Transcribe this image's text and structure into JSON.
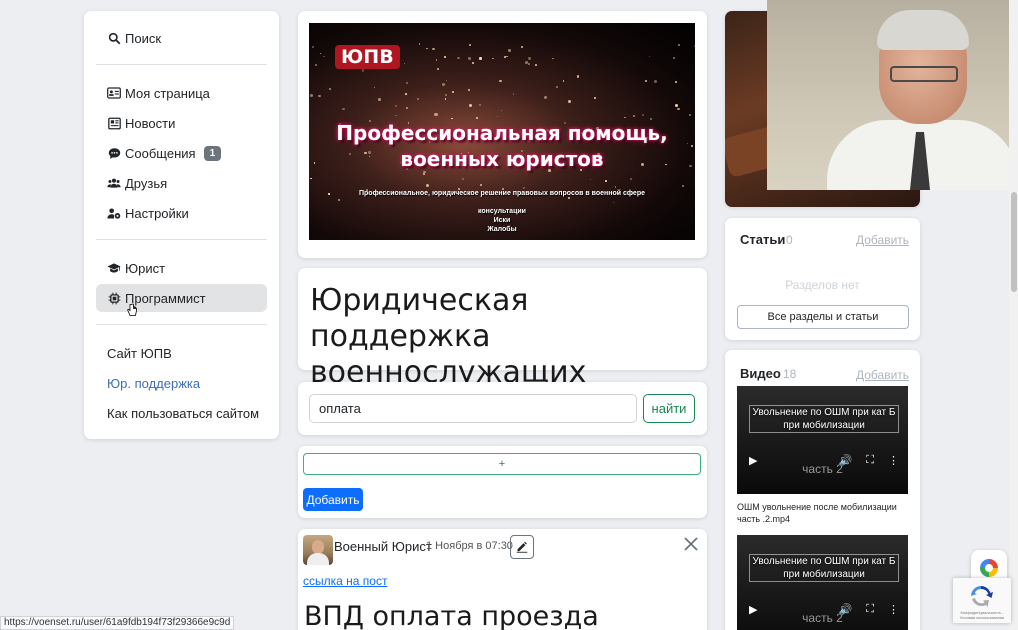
{
  "menu": {
    "search": "Поиск",
    "items": [
      {
        "label": "Моя страница",
        "icon": "id-card-icon"
      },
      {
        "label": "Новости",
        "icon": "newspaper-icon"
      },
      {
        "label": "Сообщения",
        "icon": "chat-icon",
        "badge": "1"
      },
      {
        "label": "Друзья",
        "icon": "users-icon"
      },
      {
        "label": "Настройки",
        "icon": "user-gear-icon"
      }
    ],
    "roles": [
      {
        "label": "Юрист",
        "icon": "graduation-cap-icon"
      },
      {
        "label": "Программист",
        "icon": "chip-icon"
      }
    ],
    "links": [
      "Сайт ЮПВ",
      "Юр. поддержка",
      "Как пользоваться сайтом"
    ]
  },
  "banner": {
    "logo": "ЮПВ",
    "title_line1": "Профессиональная помощь,",
    "title_line2": "военных юристов",
    "subtitle": "Профессиональное, юридическое решение правовых вопросов в военной сфере",
    "lines": [
      "консультации",
      "Иски",
      "Жалобы"
    ]
  },
  "page_title": "Юридическая поддержка военнослужащих",
  "search": {
    "value": "оплата",
    "button": "найти"
  },
  "add_block": {
    "plus": "+",
    "button": "Добавить"
  },
  "post": {
    "author": "Военный Юрист",
    "date": "1 Ноября в 07:30",
    "link": "ссылка на пост",
    "heading": "ВПД оплата проезда"
  },
  "articles": {
    "title": "Статьи",
    "count": "0",
    "add": "Добавить",
    "empty": "Разделов нет",
    "all_button": "Все разделы и статьи"
  },
  "videos": {
    "title": "Видео",
    "count": "18",
    "add": "Добавить",
    "items": [
      {
        "caption_line1": "Увольнение по ОШМ при кат Б",
        "caption_line2": "при мобилизации",
        "part": "часть 2",
        "name": "ОШМ увольнение после мобилизации часть .2.mp4"
      },
      {
        "caption_line1": "Увольнение по ОШМ при кат Б",
        "caption_line2": "при мобилизации",
        "part": "часть 2"
      }
    ]
  },
  "status_url": "https://voenset.ru/user/61a9fdb194f73f29366e9c9d",
  "recaptcha_text": "Конфиденциальность - Условия использования",
  "colors": {
    "primary": "#0d6efd",
    "success": "#198754",
    "badge": "#6c757d",
    "link": "#3b6fb5"
  }
}
